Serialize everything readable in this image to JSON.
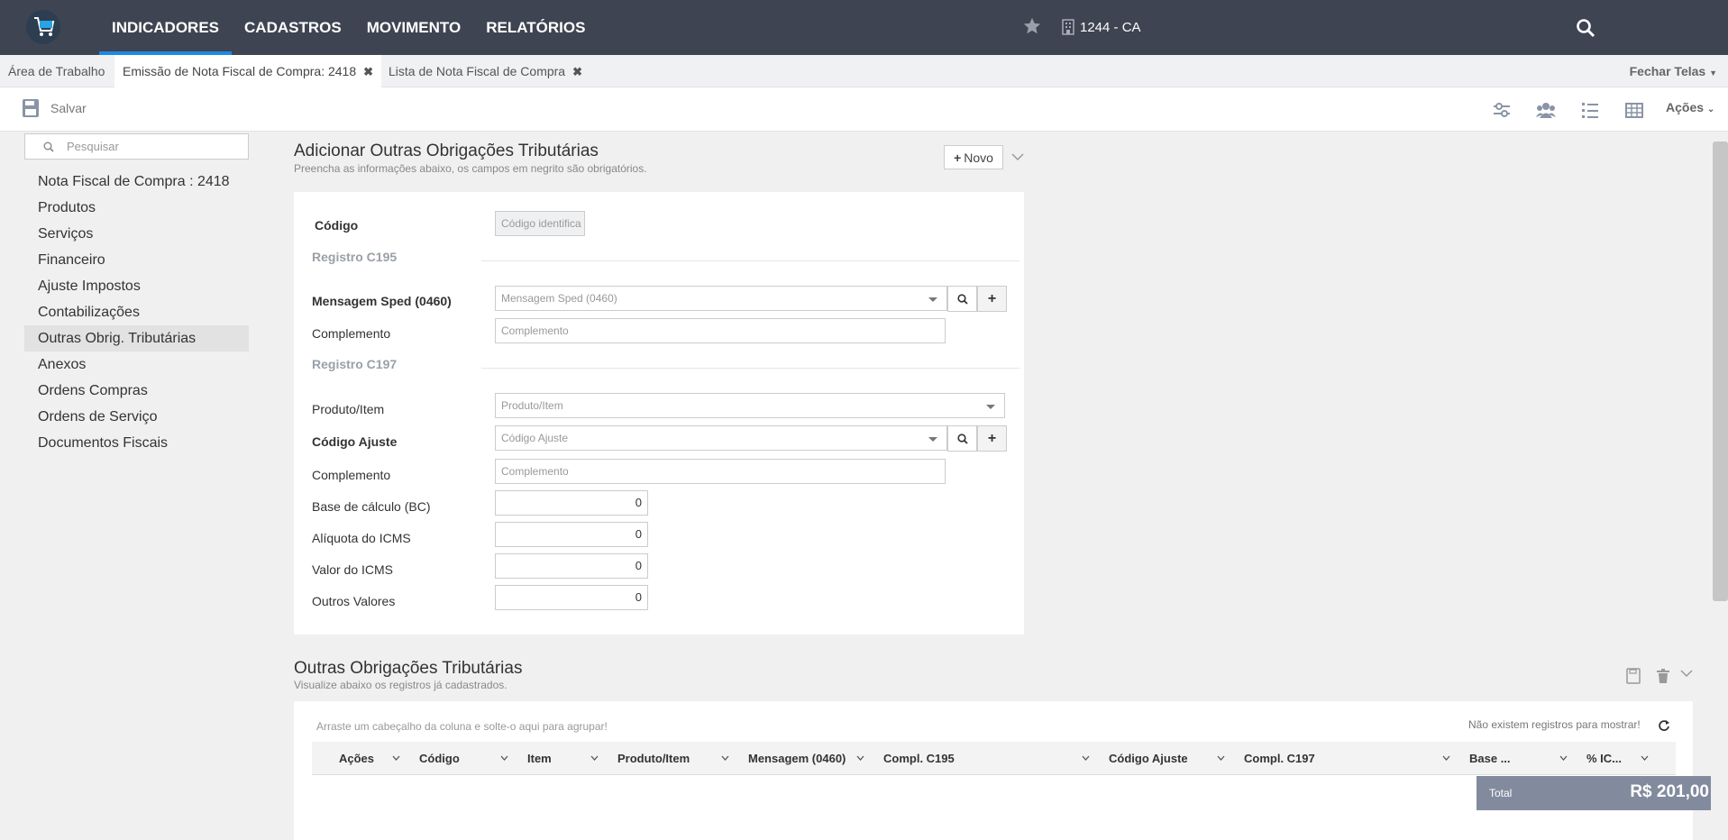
{
  "nav": {
    "items": [
      "INDICADORES",
      "CADASTROS",
      "MOVIMENTO",
      "RELATÓRIOS"
    ],
    "company": "1244 - CA"
  },
  "tabs": {
    "items": [
      "Área de Trabalho",
      "Emissão de Nota Fiscal de Compra: 2418",
      "Lista de Nota Fiscal de Compra"
    ],
    "close_all": "Fechar Telas"
  },
  "toolbar": {
    "save_label": "Salvar",
    "actions_label": "Ações"
  },
  "sidebar": {
    "search_placeholder": "Pesquisar",
    "items": [
      "Nota Fiscal de Compra : 2418",
      "Produtos",
      "Serviços",
      "Financeiro",
      "Ajuste Impostos",
      "Contabilizações",
      "Outras Obrig. Tributárias",
      "Anexos",
      "Ordens Compras",
      "Ordens de Serviço",
      "Documentos Fiscais"
    ]
  },
  "form": {
    "title": "Adicionar Outras Obrigações Tributárias",
    "subtitle": "Preencha as informações abaixo, os campos em negrito são obrigatórios.",
    "new_button": "Novo",
    "codigo_label": "Código",
    "codigo_placeholder": "Código identifica",
    "group_c195": "Registro C195",
    "mensagem_label": "Mensagem Sped (0460)",
    "mensagem_placeholder": "Mensagem Sped (0460)",
    "complemento1_label": "Complemento",
    "complemento1_placeholder": "Complemento",
    "group_c197": "Registro C197",
    "produto_label": "Produto/Item",
    "produto_placeholder": "Produto/Item",
    "ajuste_label": "Código Ajuste",
    "ajuste_placeholder": "Código Ajuste",
    "complemento2_label": "Complemento",
    "complemento2_placeholder": "Complemento",
    "base_label": "Base de cálculo (BC)",
    "base_value": "0",
    "aliquota_label": "Alíquota do ICMS",
    "aliquota_value": "0",
    "valor_label": "Valor do ICMS",
    "valor_value": "0",
    "outros_label": "Outros Valores",
    "outros_value": "0"
  },
  "grid": {
    "title": "Outras Obrigações Tributárias",
    "subtitle": "Visualize abaixo os registros já cadastrados.",
    "drag_hint": "Arraste um cabeçalho da coluna e solte-o aqui para agrupar!",
    "no_records": "Não existem registros para mostrar!",
    "columns": [
      "Ações",
      "Código",
      "Item",
      "Produto/Item",
      "Mensagem (0460)",
      "Compl. C195",
      "Código Ajuste",
      "Compl. C197",
      "Base ...",
      "% IC..."
    ]
  },
  "total": {
    "label": "Total",
    "value": "R$ 201,00"
  },
  "colors": {
    "navbar": "#3e4451",
    "accent": "#1e88e5",
    "total_bg": "#828b9e"
  }
}
